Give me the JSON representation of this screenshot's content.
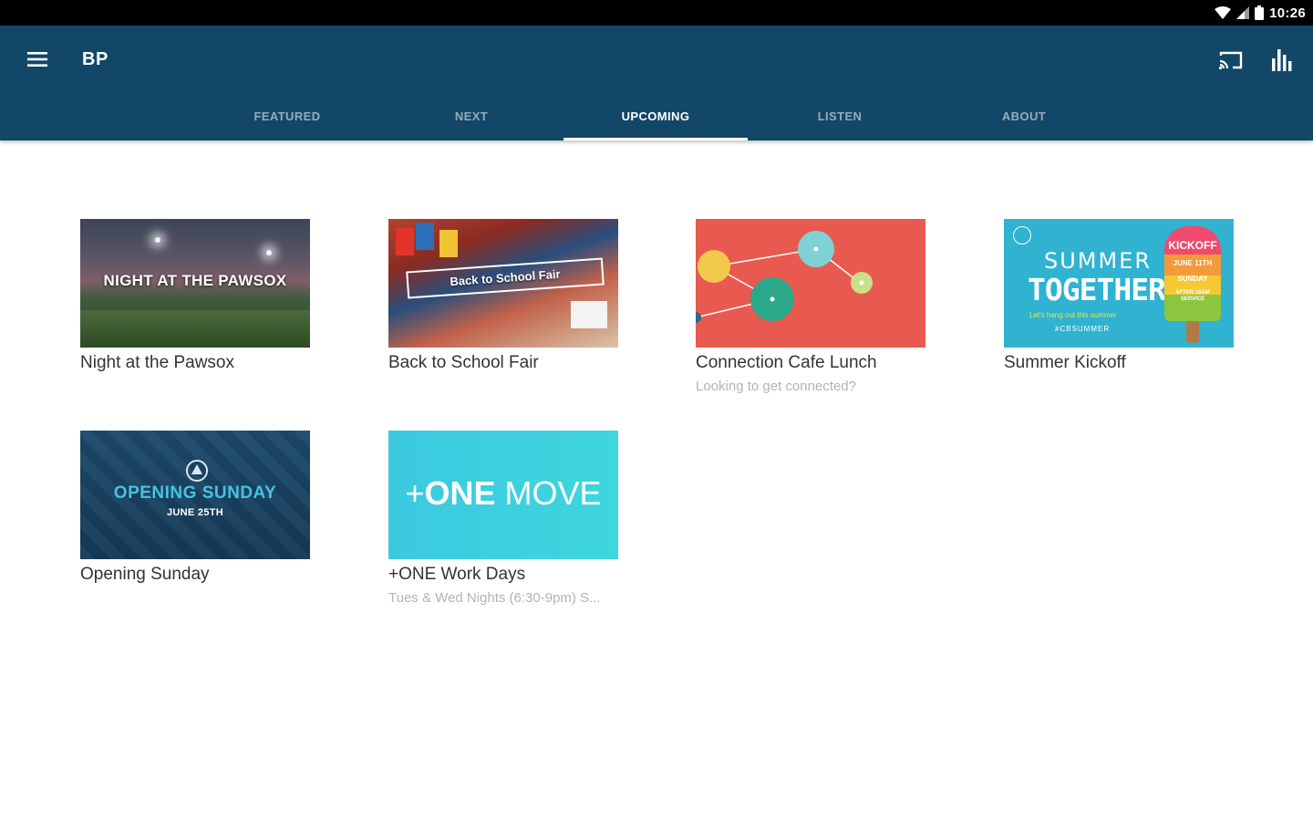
{
  "status_bar": {
    "time": "10:26",
    "icons": [
      "wifi-icon",
      "cell-signal-icon",
      "battery-icon"
    ]
  },
  "app_bar": {
    "title": "BP",
    "menu_icon": "hamburger-menu-icon",
    "cast_icon": "cast-icon",
    "stats_icon": "equalizer-icon",
    "background": "#124767"
  },
  "tabs": [
    {
      "label": "FEATURED",
      "active": false
    },
    {
      "label": "NEXT",
      "active": false
    },
    {
      "label": "UPCOMING",
      "active": true
    },
    {
      "label": "LISTEN",
      "active": false
    },
    {
      "label": "ABOUT",
      "active": false
    }
  ],
  "cards": [
    {
      "title": "Night at the Pawsox",
      "subtitle": "",
      "thumb_text": "NIGHT AT THE PAWSOX"
    },
    {
      "title": "Back to School Fair",
      "subtitle": "",
      "thumb_text": "Back to School Fair"
    },
    {
      "title": "Connection Cafe Lunch",
      "subtitle": "Looking to get connected?"
    },
    {
      "title": "Summer Kickoff",
      "subtitle": "",
      "thumb_text": {
        "line1": "SUMMER",
        "line2": "TOGETHER",
        "line3": "Let's hang out this summer",
        "line4": "#CBSUMMER",
        "pop_lines": [
          "KICKOFF",
          "JUNE 11TH",
          "SUNDAY",
          "AFTER 10AM",
          "SERVICE"
        ]
      }
    },
    {
      "title": "Opening Sunday",
      "subtitle": "",
      "thumb_text": {
        "line1": "OPENING SUNDAY",
        "line2": "JUNE 25TH"
      }
    },
    {
      "title": "+ONE Work Days",
      "subtitle": "Tues & Wed Nights (6:30-9pm) S...",
      "thumb_text": {
        "plus": "+",
        "bold": "ONE",
        "light": " MOVE"
      }
    }
  ]
}
